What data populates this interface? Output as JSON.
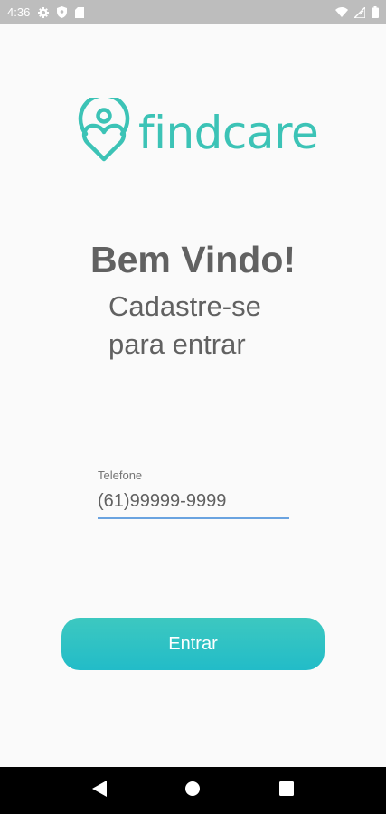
{
  "status_bar": {
    "time": "4:36",
    "left_icons": [
      "settings-icon",
      "shield-icon",
      "sd-card-icon"
    ],
    "right_icons": [
      "wifi-icon",
      "signal-icon",
      "battery-icon"
    ]
  },
  "logo": {
    "text": "findcare",
    "color": "#3cc3b6"
  },
  "welcome": {
    "title": "Bem Vindo!",
    "subtitle_line1": "Cadastre-se",
    "subtitle_line2": "para entrar"
  },
  "phone": {
    "label": "Telefone",
    "placeholder": "(61)99999-9999",
    "value": ""
  },
  "enter_button": {
    "label": "Entrar",
    "color_top": "#3dc8c0",
    "color_bottom": "#22bcc8"
  },
  "nav_bar": {
    "buttons": [
      "back-icon",
      "home-icon",
      "recents-icon"
    ]
  }
}
